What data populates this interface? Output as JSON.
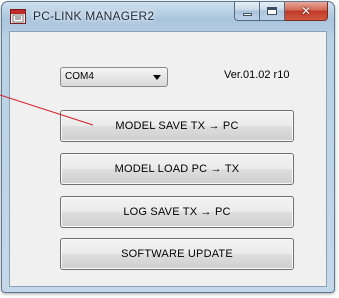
{
  "window": {
    "title": "PC-LINK MANAGER2"
  },
  "controls": {
    "port_select": {
      "value": "COM4"
    },
    "version": "Ver.01.02 r10"
  },
  "buttons": {
    "model_save": "MODEL SAVE TX → PC",
    "model_load": "MODEL LOAD PC → TX",
    "log_save": "LOG SAVE TX → PC",
    "software_update": "SOFTWARE UPDATE"
  },
  "annotation": {
    "callout_color": "#d21f2a"
  }
}
